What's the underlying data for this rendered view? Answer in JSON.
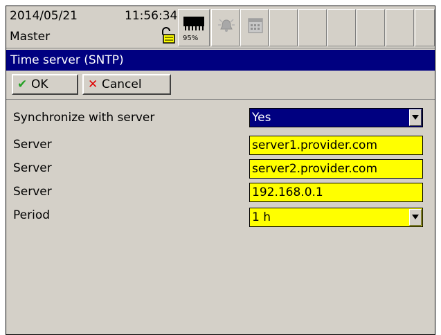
{
  "status": {
    "date": "2014/05/21",
    "time": "11:56:34",
    "user": "Master",
    "memory_percent": "95%",
    "icons": [
      "lock-icon",
      "memory-chip-icon",
      "alarm-bell-icon",
      "calendar-icon"
    ]
  },
  "dialog": {
    "title": "Time server (SNTP)",
    "ok_label": "OK",
    "cancel_label": "Cancel"
  },
  "settings": {
    "sync": {
      "label": "Synchronize with server",
      "value": "Yes"
    },
    "server1": {
      "label": "Server",
      "value": "server1.provider.com"
    },
    "server2": {
      "label": "Server",
      "value": "server2.provider.com"
    },
    "server3": {
      "label": "Server",
      "value": "192.168.0.1"
    },
    "period": {
      "label": "Period",
      "value": "1 h"
    }
  },
  "colors": {
    "title_bar": "#000080",
    "field_highlight": "#ffff00",
    "background": "#d4d0c8"
  }
}
